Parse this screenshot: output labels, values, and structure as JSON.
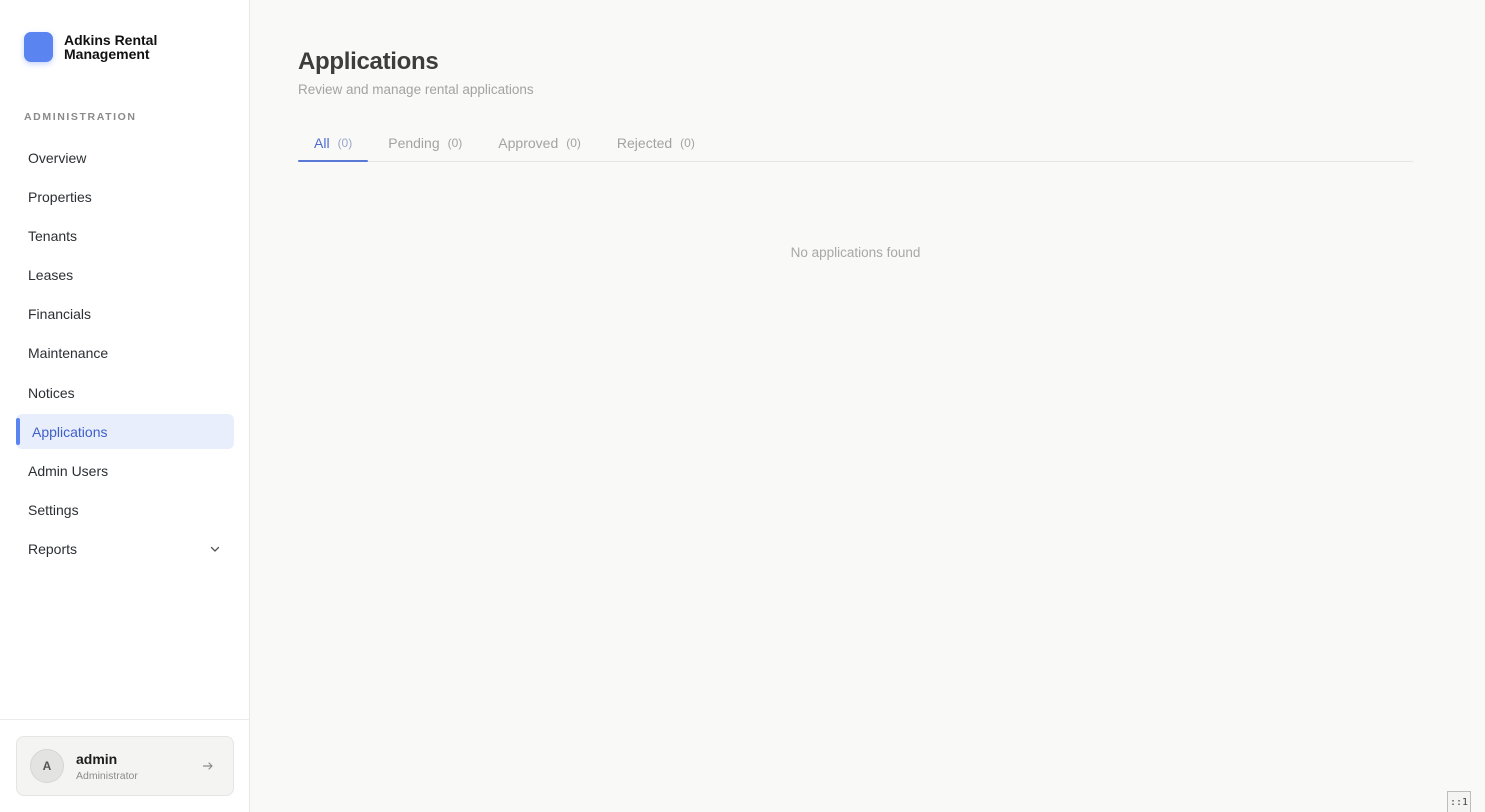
{
  "brand": {
    "name": "Adkins Rental Management",
    "logo_color": "#5a84f0"
  },
  "sidebar": {
    "section_label": "ADMINISTRATION",
    "items": [
      {
        "label": "Overview"
      },
      {
        "label": "Properties"
      },
      {
        "label": "Tenants"
      },
      {
        "label": "Leases"
      },
      {
        "label": "Financials"
      },
      {
        "label": "Maintenance"
      },
      {
        "label": "Notices"
      },
      {
        "label": "Applications",
        "active": true
      },
      {
        "label": "Admin Users"
      },
      {
        "label": "Settings"
      },
      {
        "label": "Reports",
        "icon": "chevron-down-icon"
      }
    ]
  },
  "user": {
    "avatar_initial": "A",
    "name": "admin",
    "role": "Administrator",
    "logout_icon": "arrow-right-icon"
  },
  "main": {
    "title": "Applications",
    "subtitle": "Review and manage rental applications",
    "tabs": [
      {
        "label": "All",
        "count": "(0)",
        "active": true
      },
      {
        "label": "Pending",
        "count": "(0)"
      },
      {
        "label": "Approved",
        "count": "(0)"
      },
      {
        "label": "Rejected",
        "count": "(0)"
      }
    ],
    "empty_message": "No applications found"
  },
  "corner_badge": "::1",
  "colors": {
    "accent": "#5a78d6",
    "active_bg": "#e8eefc"
  }
}
